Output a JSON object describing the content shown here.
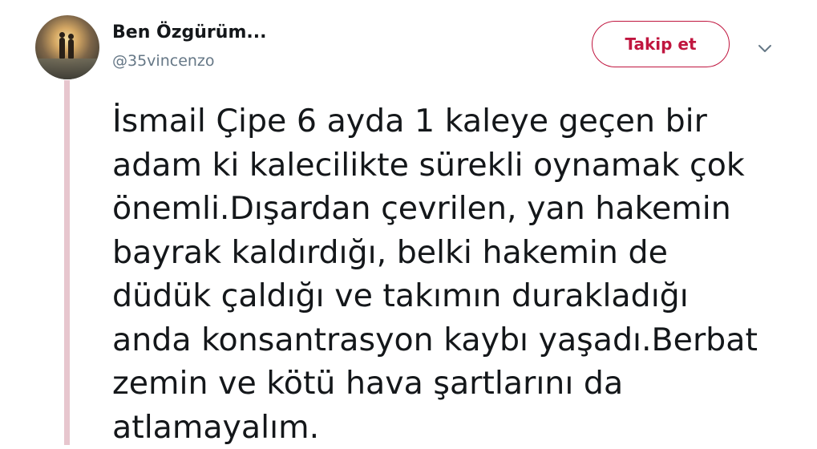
{
  "author": {
    "display_name": "Ben Özgürüm...",
    "handle": "@35vincenzo",
    "avatar_icon": "avatar-photo-couple-at-sunset"
  },
  "actions": {
    "follow_label": "Takip et",
    "menu_icon": "chevron-down-icon"
  },
  "tweet": {
    "lines": [
      "İsmail Çipe 6 ayda 1 kaleye geçen bir",
      "adam ki kalecilikte sürekli oynamak çok",
      "önemli.Dışardan çevrilen, yan hakemin",
      "bayrak kaldırdığı, belki hakemin de",
      "düdük çaldığı ve takımın durakladığı",
      "anda konsantrasyon kaybı yaşadı.Berbat",
      "zemin ve kötü hava şartlarını da",
      "atlamayalım."
    ]
  },
  "colors": {
    "accent": "#c0163f",
    "thread_line": "#e7c6ce",
    "handle_text": "#657786",
    "body_text": "#14171a"
  }
}
